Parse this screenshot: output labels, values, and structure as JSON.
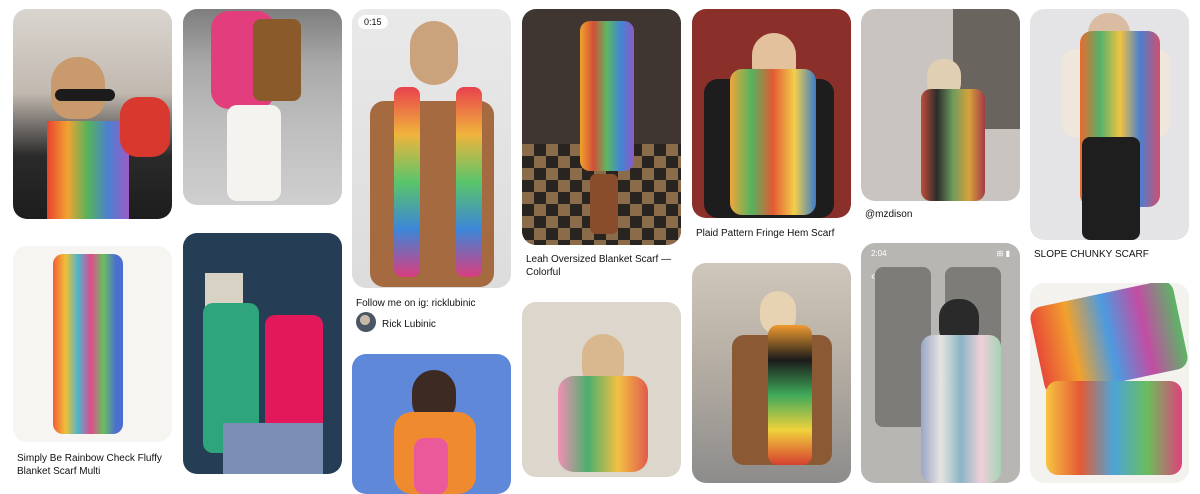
{
  "pins": [
    {
      "id": "p1",
      "caption": ""
    },
    {
      "id": "p2",
      "caption": ""
    },
    {
      "id": "p3",
      "caption_line1": "Follow me on ig: ricklubinic",
      "author": "Rick Lubinic",
      "video_time": "0:15"
    },
    {
      "id": "p4",
      "caption_line1": "Leah Oversized Blanket Scarf —",
      "caption_line2": "Colorful"
    },
    {
      "id": "p5",
      "caption_line1": "Plaid Pattern Fringe Hem Scarf"
    },
    {
      "id": "p6",
      "caption_line1": "@mzdison"
    },
    {
      "id": "p7",
      "caption_line1": "SLOPE CHUNKY SCARF"
    },
    {
      "id": "p8",
      "caption_line1": "Simply Be Rainbow Check Fluffy",
      "caption_line2": "Blanket Scarf Multi"
    },
    {
      "id": "p9",
      "caption": ""
    },
    {
      "id": "p10",
      "caption": ""
    },
    {
      "id": "p11",
      "caption": ""
    },
    {
      "id": "p12",
      "caption": ""
    },
    {
      "id": "p13",
      "status_time": "2:04",
      "status_icons": "⊞ ▮"
    },
    {
      "id": "p14",
      "caption": ""
    }
  ],
  "colors": {
    "background": "#ffffff",
    "text": "#111111",
    "radius_note": "rounded tiles"
  }
}
